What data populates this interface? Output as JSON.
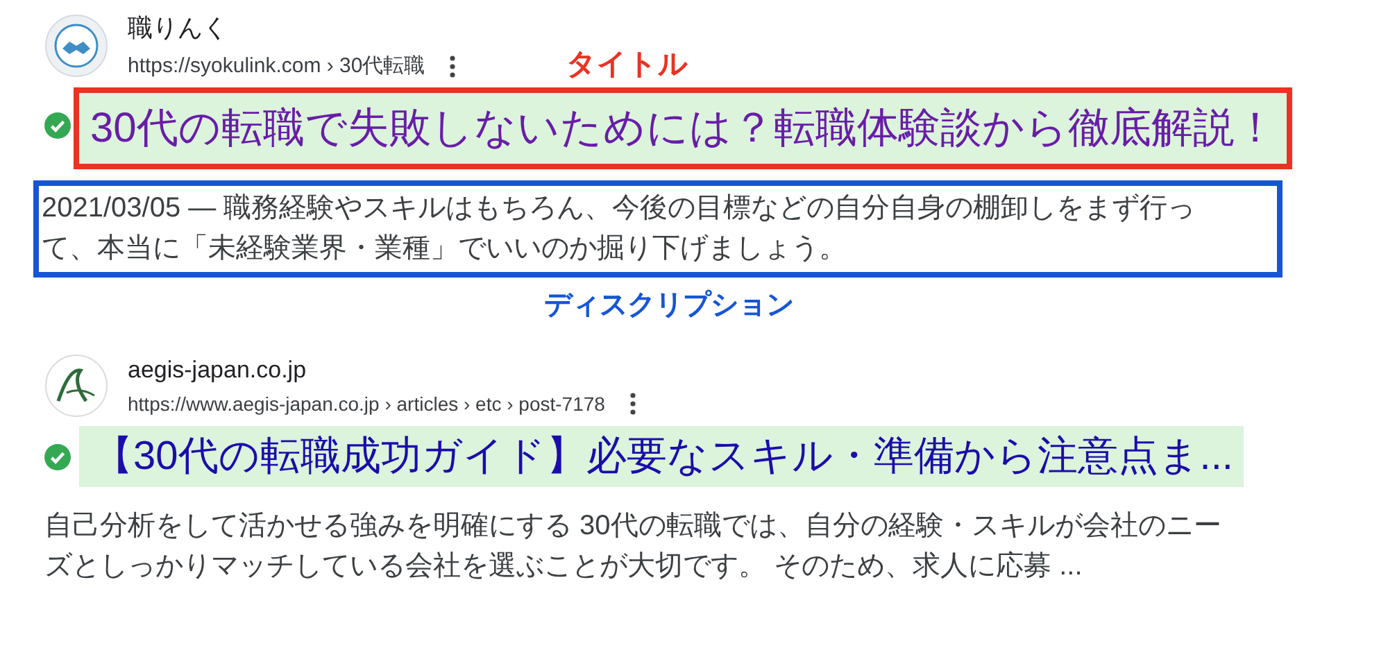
{
  "results": [
    {
      "favicon": {
        "kind": "handshake"
      },
      "site_name": "職りんく",
      "url": "https://syokulink.com › 30代転職",
      "verified": true,
      "visited": true,
      "title": "30代の転職で失敗しないためには？転職体験談から徹底解説！",
      "snippet_lines": [
        "2021/03/05 — 職務経験やスキルはもちろん、今後の目標などの自分自身の棚卸しをまず行っ",
        "て、本当に「未経験業界・業種」でいいのか掘り下げましょう。"
      ],
      "annotated": true
    },
    {
      "favicon": {
        "kind": "swoosh"
      },
      "site_name": "aegis-japan.co.jp",
      "url": "https://www.aegis-japan.co.jp › articles › etc › post-7178",
      "verified": true,
      "visited": false,
      "title": "【30代の転職成功ガイド】必要なスキル・準備から注意点ま...",
      "snippet_lines": [
        "自己分析をして活かせる強みを明確にする 30代の転職では、自分の経験・スキルが会社のニー",
        "ズとしっかりマッチしている会社を選ぶことが大切です。 そのため、求人に応募 ..."
      ],
      "annotated": false
    }
  ],
  "annotations": [
    {
      "kind": "title",
      "label": "タイトル",
      "color": "#ea3323"
    },
    {
      "kind": "snippet",
      "label": "ディスクリプション",
      "color": "#1656d6"
    }
  ]
}
